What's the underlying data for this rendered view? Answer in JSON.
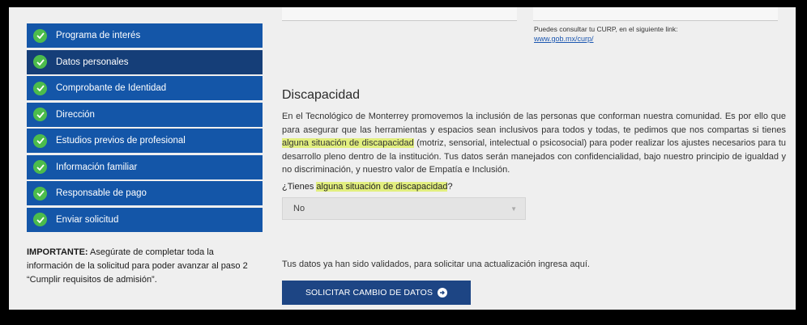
{
  "sidebar": {
    "items": [
      {
        "label": "Programa de interés",
        "active": false
      },
      {
        "label": "Datos personales",
        "active": true
      },
      {
        "label": "Comprobante de Identidad",
        "active": false
      },
      {
        "label": "Dirección",
        "active": false
      },
      {
        "label": "Estudios previos de profesional",
        "active": false
      },
      {
        "label": "Información familiar",
        "active": false
      },
      {
        "label": "Responsable de pago",
        "active": false
      },
      {
        "label": "Enviar solicitud",
        "active": false
      }
    ],
    "important_label": "IMPORTANTE:",
    "important_text": "Asegúrate de completar toda la información de la solicitud para poder avanzar al paso 2 “Cumplir requisitos de admisión”."
  },
  "curp": {
    "note": "Puedes consultar tu CURP, en el siguiente link:",
    "link": "www.gob.mx/curp/"
  },
  "disability": {
    "heading": "Discapacidad",
    "paragraph_part1": "En el Tecnológico de Monterrey promovemos la inclusión de las personas que conforman nuestra comunidad. Es por ello que para asegurar que las herramientas y espacios sean inclusivos para todos y todas, te pedimos que nos compartas si tienes ",
    "paragraph_highlight": "alguna situación de discapacidad",
    "paragraph_part2": " (motriz, sensorial, intelectual o psicosocial) para poder realizar los ajustes necesarios para tu desarrollo pleno dentro de la institución. Tus datos serán manejados con confidencialidad, bajo nuestro principio de igualdad y no discriminación, y nuestro valor de Empatía e Inclusión.",
    "question_prefix": "¿Tienes ",
    "question_highlight": "alguna situación de discapacidad",
    "question_suffix": "?",
    "select_value": "No"
  },
  "validation": {
    "text": "Tus datos ya han sido validados, para solicitar una actualización ingresa aquí.",
    "button_label": "SOLICITAR CAMBIO DE DATOS"
  },
  "colors": {
    "nav_bg": "#1456a8",
    "nav_active_bg": "#153e78",
    "check_green": "#4cbc4c",
    "highlight": "#e2ef7f",
    "button_bg": "#1d4584"
  },
  "icons": {
    "nav_item": "check-circle-icon",
    "button": "arrow-circle-icon",
    "select": "chevron-down-icon"
  }
}
